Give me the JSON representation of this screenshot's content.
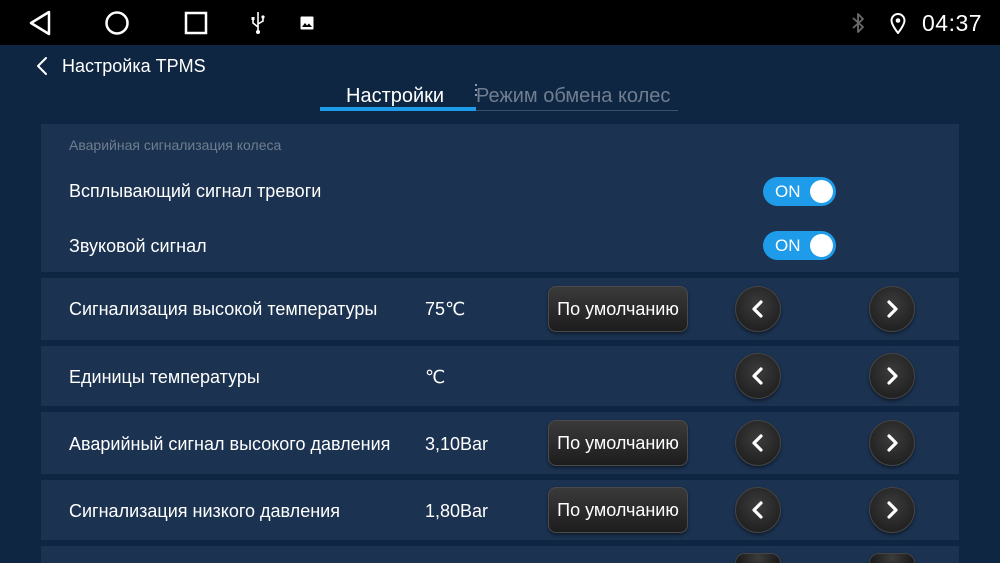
{
  "status_bar": {
    "time": "04:37",
    "icons": [
      "back-icon",
      "home-icon",
      "recent-apps-icon",
      "usb-icon",
      "image-icon",
      "bluetooth-icon",
      "location-icon"
    ]
  },
  "header": {
    "title": "Настройка TPMS"
  },
  "tabs": [
    {
      "label": "Настройки",
      "active": true
    },
    {
      "label": "Режим обмена колес",
      "active": false
    }
  ],
  "alarm_section": {
    "title": "Аварийная сигнализация колеса",
    "popup_alarm": {
      "label": "Всплывающий сигнал тревоги",
      "toggle": "ON"
    },
    "sound_alarm": {
      "label": "Звуковой сигнал",
      "toggle": "ON"
    }
  },
  "settings": [
    {
      "label": "Сигнализация высокой температуры",
      "value": "75℃",
      "default_label": "По умолчанию"
    },
    {
      "label": "Единицы температуры",
      "value": "℃"
    },
    {
      "label": "Аварийный сигнал высокого давления",
      "value": "3,10Bar",
      "default_label": "По умолчанию"
    },
    {
      "label": "Сигнализация низкого давления",
      "value": "1,80Bar",
      "default_label": "По умолчанию"
    }
  ],
  "colors": {
    "background": "#0f2642",
    "panel": "#1b3250",
    "accent": "#1e9be9",
    "muted_text": "#6f7e90"
  }
}
